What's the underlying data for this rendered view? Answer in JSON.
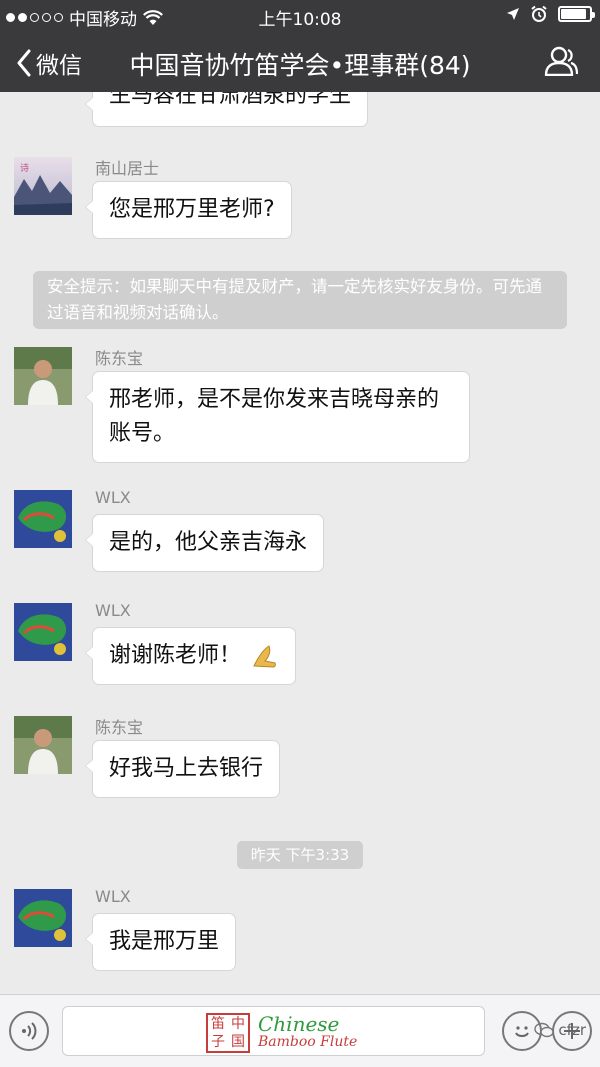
{
  "status_bar": {
    "carrier": "中国移动",
    "time": "上午10:08",
    "signal_filled": 2,
    "signal_total": 5,
    "battery_level": 0.9
  },
  "nav": {
    "back_label": "微信",
    "title": "中国音协竹笛学会•理事群(84)"
  },
  "chat": {
    "partial_message": "生马蓉在甘肃酒泉的学生",
    "system_notice": "安全提示：如果聊天中有提及财产，请一定先核实好友身份。可先通过语音和视频对话确认。",
    "timestamp": "昨天  下午3:33",
    "messages": [
      {
        "sender": "南山居士",
        "line1": "您是邢万里老师?",
        "line2": ""
      },
      {
        "sender": "陈东宝",
        "line1": "邢老师，是不是你发来吉晓母亲的",
        "line2": "账号。"
      },
      {
        "sender": "WLX",
        "line1": "是的，他父亲吉海永",
        "line2": ""
      },
      {
        "sender": "WLX",
        "line1": "谢谢陈老师！",
        "line2": ""
      },
      {
        "sender": "陈东宝",
        "line1": "好我马上去银行",
        "line2": ""
      },
      {
        "sender": "WLX",
        "line1": "我是邢万里",
        "line2": ""
      }
    ]
  },
  "input_bar": {
    "logo_seal": [
      "笛",
      "中",
      "子",
      "国"
    ],
    "logo_line1": "Chinese",
    "logo_line2": "Bamboo Flute",
    "watermark": "cfzr"
  },
  "colors": {
    "header_bg": "#3a3a3d",
    "chat_bg": "#ebebeb",
    "bubble_bg": "#ffffff",
    "notice_bg": "#cfcfcf",
    "logo_red": "#c83c3c",
    "logo_green": "#2e9b3d"
  }
}
